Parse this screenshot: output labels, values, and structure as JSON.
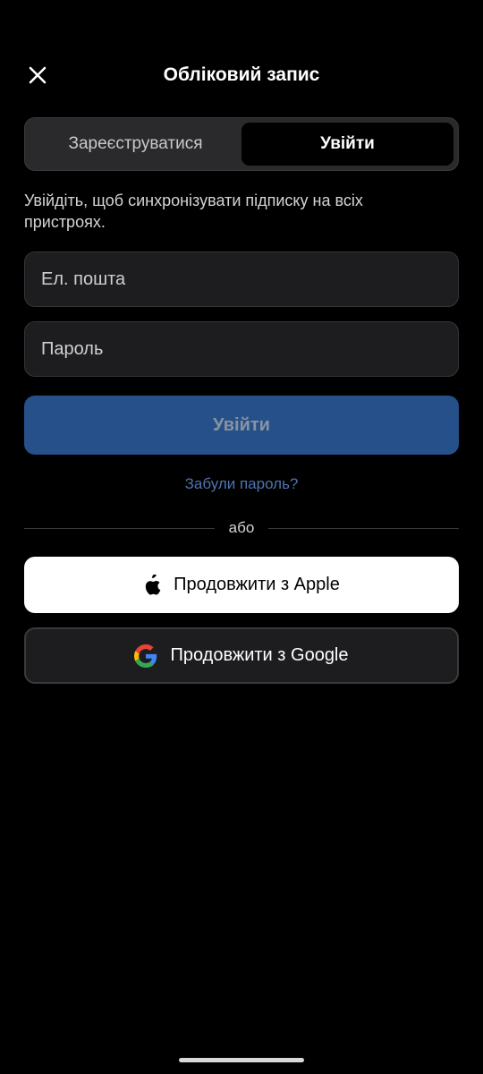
{
  "header": {
    "title": "Обліковий запис",
    "close_icon": "close-icon"
  },
  "tabs": [
    {
      "label": "Зареєструватися",
      "selected": false
    },
    {
      "label": "Увійти",
      "selected": true
    }
  ],
  "subtitle": "Увійдіть, щоб синхронізувати підписку на всіх пристроях.",
  "form": {
    "email_placeholder": "Ел. пошта",
    "password_placeholder": "Пароль",
    "submit_label": "Увійти",
    "forgot_label": "Забули пароль?"
  },
  "divider_label": "або",
  "social": {
    "apple_label": "Продовжити з Apple",
    "google_label": "Продовжити з Google",
    "apple_icon": "apple-logo-icon",
    "google_icon": "google-logo-icon"
  },
  "colors": {
    "background": "#000000",
    "primary_button": "#26508a",
    "link": "#4f74b0"
  }
}
